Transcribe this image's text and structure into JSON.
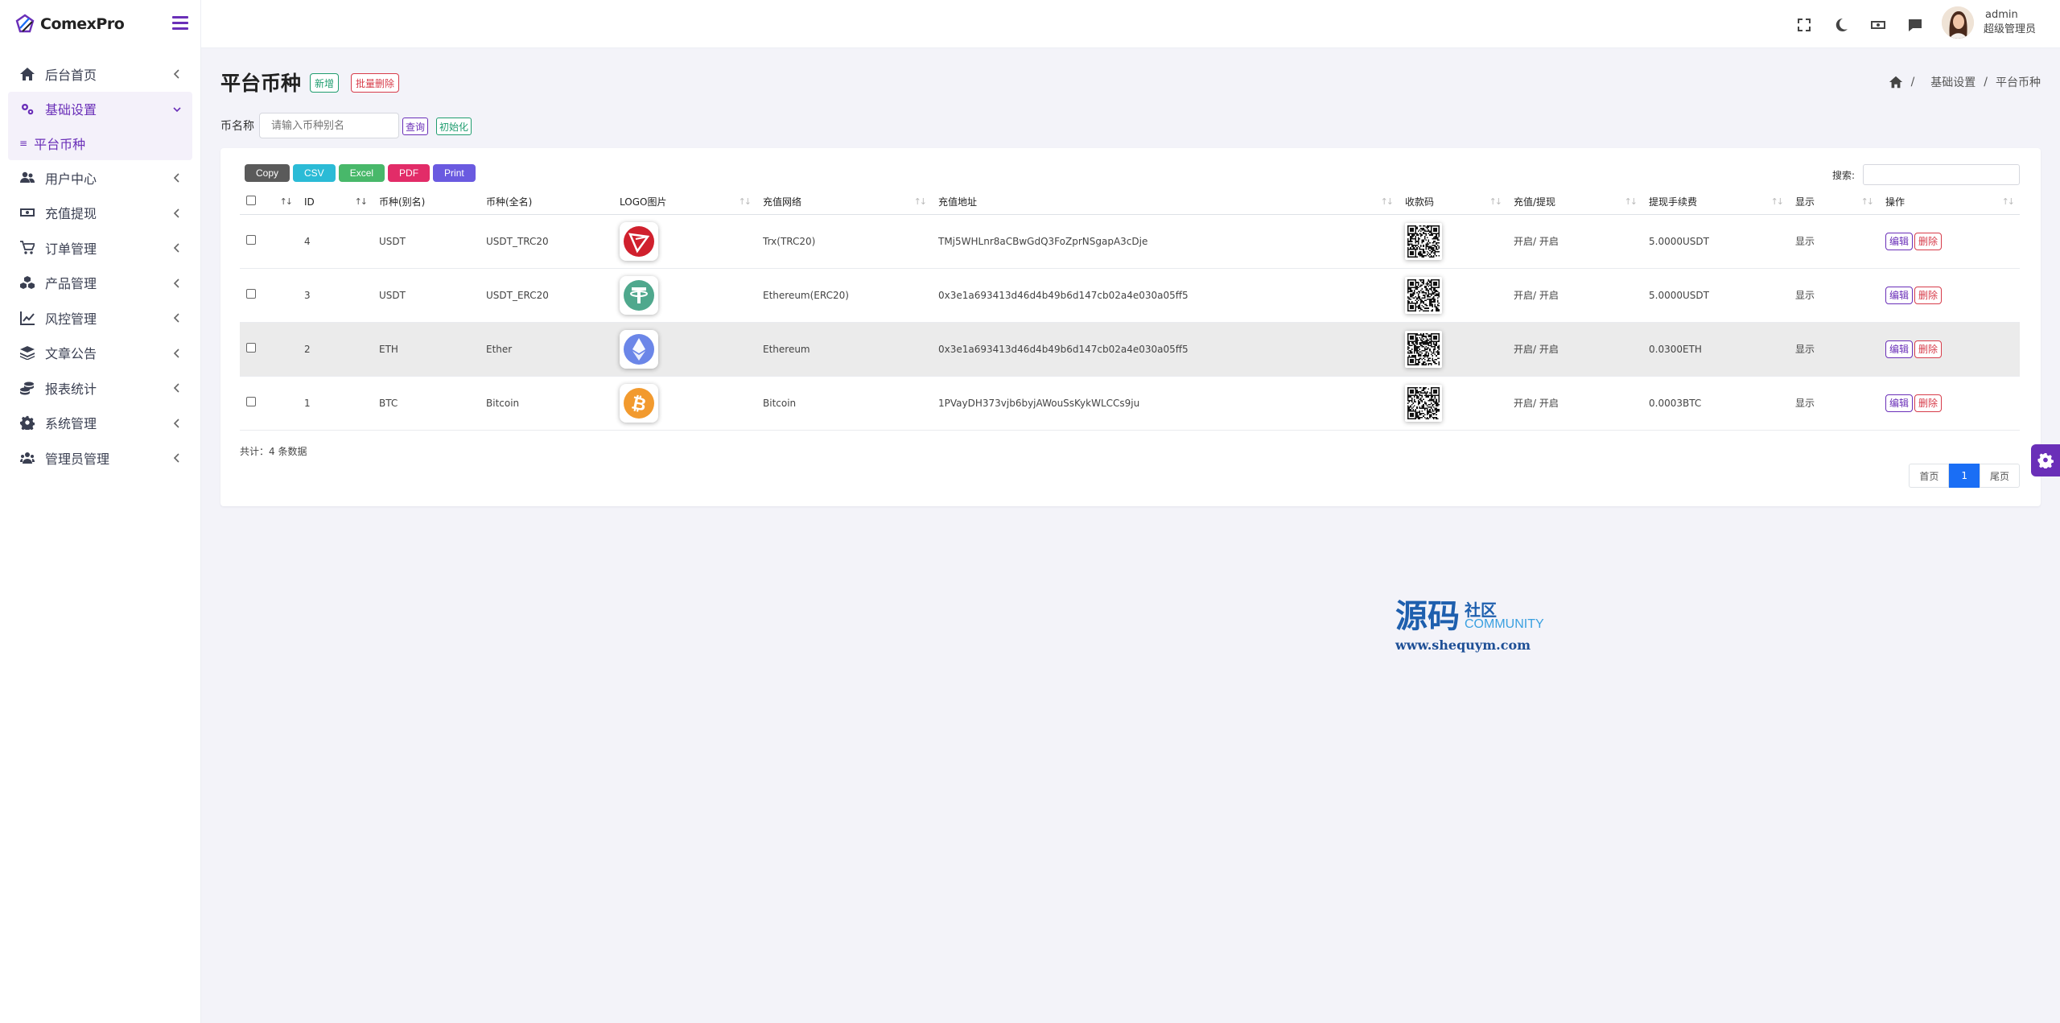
{
  "brand": {
    "name": "ComexPro"
  },
  "sidebar": {
    "items": [
      {
        "label": "后台首页",
        "icon": "home-icon"
      },
      {
        "label": "基础设置",
        "icon": "gears-icon",
        "active": true
      },
      {
        "label": "用户中心",
        "icon": "users-icon"
      },
      {
        "label": "充值提现",
        "icon": "money-icon"
      },
      {
        "label": "订单管理",
        "icon": "cart-icon"
      },
      {
        "label": "产品管理",
        "icon": "cubes-icon"
      },
      {
        "label": "风控管理",
        "icon": "chart-line-icon"
      },
      {
        "label": "文章公告",
        "icon": "layers-icon"
      },
      {
        "label": "报表统计",
        "icon": "coins-icon"
      },
      {
        "label": "系统管理",
        "icon": "gear-icon"
      },
      {
        "label": "管理员管理",
        "icon": "user-group-icon"
      }
    ],
    "sub_item": {
      "label": "平台币种",
      "bullet": "≡"
    }
  },
  "header": {
    "user": {
      "name": "admin",
      "role": "超级管理员"
    }
  },
  "page": {
    "title": "平台币种",
    "add_label": "新增",
    "batch_delete_label": "批量删除",
    "breadcrumb": {
      "level1": "基础设置",
      "level2": "平台币种",
      "sep": "/"
    }
  },
  "filter": {
    "label": "币名称",
    "placeholder": "请输入币种别名",
    "query_label": "查询",
    "init_label": "初始化"
  },
  "toolbar": {
    "buttons": [
      {
        "label": "Copy",
        "color": "#5a5a5a"
      },
      {
        "label": "CSV",
        "color": "#2bbbd6"
      },
      {
        "label": "Excel",
        "color": "#48b86a"
      },
      {
        "label": "PDF",
        "color": "#e22c68"
      },
      {
        "label": "Print",
        "color": "#6a5ae0"
      }
    ],
    "search_label": "搜索:"
  },
  "table": {
    "headers": [
      "ID",
      "币种(别名)",
      "币种(全名)",
      "LOGO图片",
      "充值网络",
      "充值地址",
      "收款码",
      "充值/提现",
      "提现手续费",
      "显示",
      "操作"
    ],
    "rows": [
      {
        "id": "4",
        "alias": "USDT",
        "fullname": "USDT_TRC20",
        "logo": "tron-icon",
        "network": "Trx(TRC20)",
        "address": "TMj5WHLnr8aCBwGdQ3FoZprNSgapA3cDje",
        "status": "开启/ 开启",
        "fee": "5.0000USDT",
        "show": "显示",
        "edit": "编辑",
        "delete": "删除"
      },
      {
        "id": "3",
        "alias": "USDT",
        "fullname": "USDT_ERC20",
        "logo": "tether-icon",
        "network": "Ethereum(ERC20)",
        "address": "0x3e1a693413d46d4b49b6d147cb02a4e030a05ff5",
        "status": "开启/ 开启",
        "fee": "5.0000USDT",
        "show": "显示",
        "edit": "编辑",
        "delete": "删除"
      },
      {
        "id": "2",
        "alias": "ETH",
        "fullname": "Ether",
        "logo": "ethereum-icon",
        "network": "Ethereum",
        "address": "0x3e1a693413d46d4b49b6d147cb02a4e030a05ff5",
        "status": "开启/ 开启",
        "fee": "0.0300ETH",
        "show": "显示",
        "edit": "编辑",
        "delete": "删除"
      },
      {
        "id": "1",
        "alias": "BTC",
        "fullname": "Bitcoin",
        "logo": "bitcoin-icon",
        "network": "Bitcoin",
        "address": "1PVayDH373vjb6byjAWouSsKykWLCCs9ju",
        "status": "开启/ 开启",
        "fee": "0.0003BTC",
        "show": "显示",
        "edit": "编辑",
        "delete": "删除"
      }
    ],
    "total": "共计：4 条数据"
  },
  "pagination": {
    "first": "首页",
    "current": "1",
    "last": "尾页"
  },
  "watermark": {
    "big": "源码",
    "cn": "社区",
    "en": "COMMUNITY",
    "url": "www.shequym.com"
  },
  "colors": {
    "accent": "#6a2fb8",
    "page_bg": "#f3f3f9",
    "primary_blue": "#1a6ef5"
  }
}
